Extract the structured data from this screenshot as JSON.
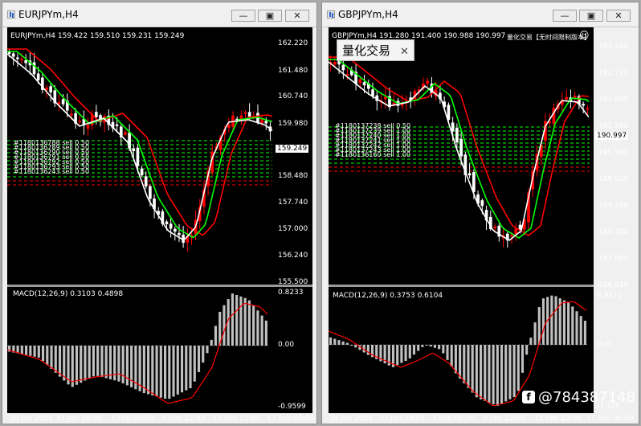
{
  "windows": [
    {
      "title": "EURJPYm,H4",
      "info": "EURJPYm,H4  159.422 159.510 159.231 159.249",
      "current_price": "159.249",
      "y_labels": [
        "162.220",
        "161.480",
        "160.740",
        "159.980",
        "158.480",
        "157.740",
        "157.000",
        "156.240",
        "155.500"
      ],
      "macd_label": "MACD(12,26,9) 0.3103 0.4898",
      "macd_y_labels": [
        "0.8233",
        "0.00",
        "-0.9599"
      ],
      "x_labels": [
        "29 Jan 2025",
        "31 Jan 20:00",
        "5 Feb 08:00",
        "9 Feb 22:05",
        "12 Feb 12:00",
        "17 Feb 00:00"
      ],
      "order_labels": [
        "#1180136788 sell 0.50",
        "#1180136789 sell 0.50",
        "#1180136790 sell 0.50",
        "#1180136791 sell 0.50",
        "#1180136792 sell 0.50",
        "#1180136793 sell 0.50",
        "#1180136243 sell 0.50"
      ]
    },
    {
      "title": "GBPJPYm,H4",
      "info": "GBPJPYm,H4  191.280 191.400 190.988 190.997",
      "ea_label": "量化交易【无时间限制版本】",
      "current_price": "190.997",
      "y_labels": [
        "193.440",
        "192.720",
        "191.980",
        "191.260",
        "190.540",
        "189.820",
        "189.100",
        "188.380",
        "187.660",
        "186.940"
      ],
      "macd_label": "MACD(12,26,9) 0.3753 0.6104",
      "macd_y_labels": [
        "0.9271",
        "0.00",
        "-1.126"
      ],
      "x_labels": [
        "29 Jan 2025",
        "31 Jan 20:00",
        "5 Feb 08:00",
        "9 Feb 22:05",
        "12 Feb 12:00",
        "17 Feb 00:00"
      ],
      "order_labels": [
        "#1180137238 sell 0.50",
        "#1180137239 sell 1.00",
        "#1180137240 sell 1.00",
        "#1180137241 sell 1.00",
        "#1180137242 sell 1.00",
        "#1180137243 sell 1.00",
        "#1180136160 sell 1.00"
      ]
    }
  ],
  "popup": {
    "text": "量化交易",
    "close": "✕"
  },
  "window_controls": {
    "minimize": "—",
    "restore": "▣",
    "close": "✕"
  },
  "watermark": {
    "icon": "f",
    "text": "@784387148"
  },
  "colors": {
    "bull": "#ff0000",
    "bear": "#ffffff",
    "ma1": "#ff0000",
    "ma2": "#00ff00",
    "ma3": "#ffffff",
    "macd_hist": "#c0c0c0",
    "signal": "#ff0000",
    "order_line": "#00ff00",
    "order_line_alt": "#ff0000"
  }
}
